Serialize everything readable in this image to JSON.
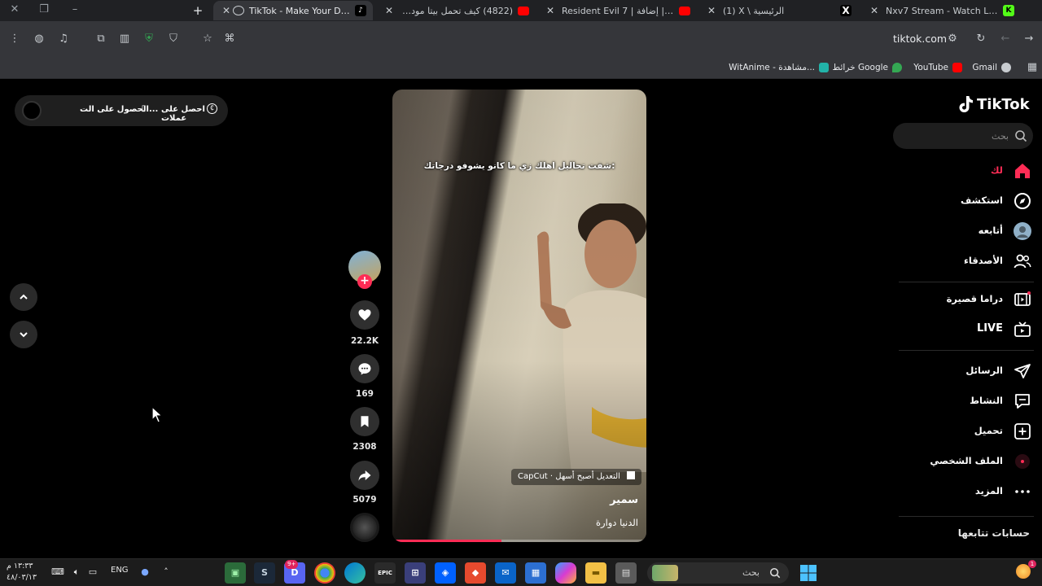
{
  "browser": {
    "tabs": [
      {
        "title": "TikTok - Make Your Day",
        "favicon": "tiktok-icon",
        "active": true
      },
      {
        "title": "(4822) كيف تحمل بيتا مودرن وراء",
        "favicon": "youtube-icon"
      },
      {
        "title": "Resident Evil 7 | إضافة | End of Zoe",
        "favicon": "youtube-icon"
      },
      {
        "title": "(1) X \\ الرئيسية",
        "favicon": "x-icon"
      },
      {
        "title": "Nxv7 Stream - Watch Live on Kick",
        "favicon": "kick-icon"
      }
    ],
    "address": "tiktok.com",
    "bookmarks": [
      {
        "label": "Gmail",
        "color": "#c8ccd0"
      },
      {
        "label": "YouTube",
        "color": "#ff0000"
      },
      {
        "label": "خرائط Google",
        "color": "#34a853"
      },
      {
        "label": "WitAnime - مشاهدة...",
        "color": "#22b3a8"
      }
    ]
  },
  "tiktok": {
    "logo": "TikTok",
    "search_placeholder": "بحث",
    "nav": [
      {
        "label": "لك",
        "icon": "home-icon",
        "active": true
      },
      {
        "label": "استكشف",
        "icon": "compass-icon"
      },
      {
        "label": "أتابعه",
        "icon": "avatar-icon"
      },
      {
        "label": "الأصدقاء",
        "icon": "friends-icon"
      },
      {
        "label": "دراما قصيرة",
        "icon": "film-icon"
      },
      {
        "label": "LIVE",
        "icon": "live-icon"
      },
      {
        "label": "الرسائل",
        "icon": "send-icon"
      },
      {
        "label": "النشاط",
        "icon": "message-icon"
      },
      {
        "label": "تحميل",
        "icon": "upload-icon"
      },
      {
        "label": "الملف الشخصي",
        "icon": "profile-icon"
      },
      {
        "label": "المزيد",
        "icon": "more-icon"
      }
    ],
    "following_title": "حسابات تتابعها",
    "promo": {
      "get_coins": "احصل على عملات",
      "get_app": "الحصول على الت..."
    },
    "video": {
      "caption": "شفت تحاليل اهلك زي ما كانو يشوفو درجاتك:",
      "capcut_badge": "CapCut · التعديل أصبح أسهل",
      "author": "سمير",
      "description": "الدنيا دوارة",
      "progress": 0.43
    },
    "actions": {
      "likes": "22.2K",
      "comments": "169",
      "saves": "2308",
      "shares": "5079"
    },
    "accent": "#fe2c55"
  },
  "taskbar": {
    "search_label": "بحث",
    "language": "ENG",
    "time": "١٣:٣٣ م",
    "date": "٤٨/٠٣/١٣",
    "discord_badge": "9+"
  }
}
